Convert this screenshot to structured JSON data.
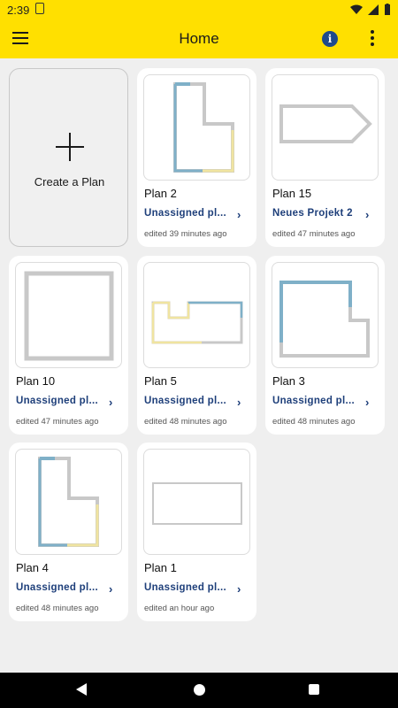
{
  "status_bar": {
    "time": "2:39"
  },
  "app_bar": {
    "title": "Home"
  },
  "create": {
    "label": "Create a Plan"
  },
  "plans": [
    {
      "name": "Plan 2",
      "project": "Unassigned pl...",
      "time": "edited 39 minutes ago"
    },
    {
      "name": "Plan 15",
      "project": "Neues Projekt 2",
      "time": "edited 47 minutes ago"
    },
    {
      "name": "Plan 10",
      "project": "Unassigned pl...",
      "time": "edited 47 minutes ago"
    },
    {
      "name": "Plan 5",
      "project": "Unassigned pl...",
      "time": "edited 48 minutes ago"
    },
    {
      "name": "Plan 3",
      "project": "Unassigned pl...",
      "time": "edited 48 minutes ago"
    },
    {
      "name": "Plan 4",
      "project": "Unassigned pl...",
      "time": "edited 48 minutes ago"
    },
    {
      "name": "Plan 1",
      "project": "Unassigned pl...",
      "time": "edited an hour ago"
    }
  ],
  "colors": {
    "accent": "#ffe000",
    "link": "#1e3f7a",
    "wall_blue": "#7fb0c8",
    "wall_yellow": "#f0e4a0",
    "wall_gray": "#c8c8c8"
  }
}
